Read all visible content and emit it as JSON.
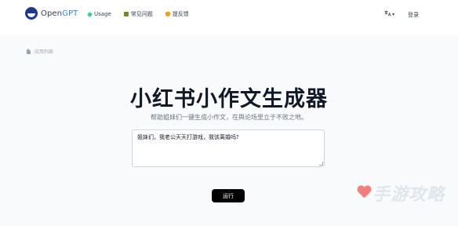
{
  "header": {
    "logo_prefix": "Open",
    "logo_accent": "GPT",
    "nav": [
      {
        "label": "Usage",
        "icon": "usage-icon"
      },
      {
        "label": "常见问题",
        "icon": "faq-icon"
      },
      {
        "label": "提反馈",
        "icon": "feedback-icon"
      }
    ],
    "language_icon": "translate-icon",
    "language_caret": "▾",
    "login_label": "登录"
  },
  "breadcrumb": {
    "icon": "home-icon",
    "label": "应用列表"
  },
  "main": {
    "title": "小红书小作文生成器",
    "subtitle": "帮助姐妹们一键生成小作文，在舆论场里立于不败之地。",
    "input_value": "姐妹们，我老公天天打游戏，我该离婚吗?",
    "run_label": "运行"
  },
  "watermark": {
    "text": "手游攻略"
  },
  "colors": {
    "logo_dark": "#1e3a8a",
    "logo_accent": "#3b82f6",
    "button_bg": "#000000",
    "page_bg": "#f9fafb"
  }
}
